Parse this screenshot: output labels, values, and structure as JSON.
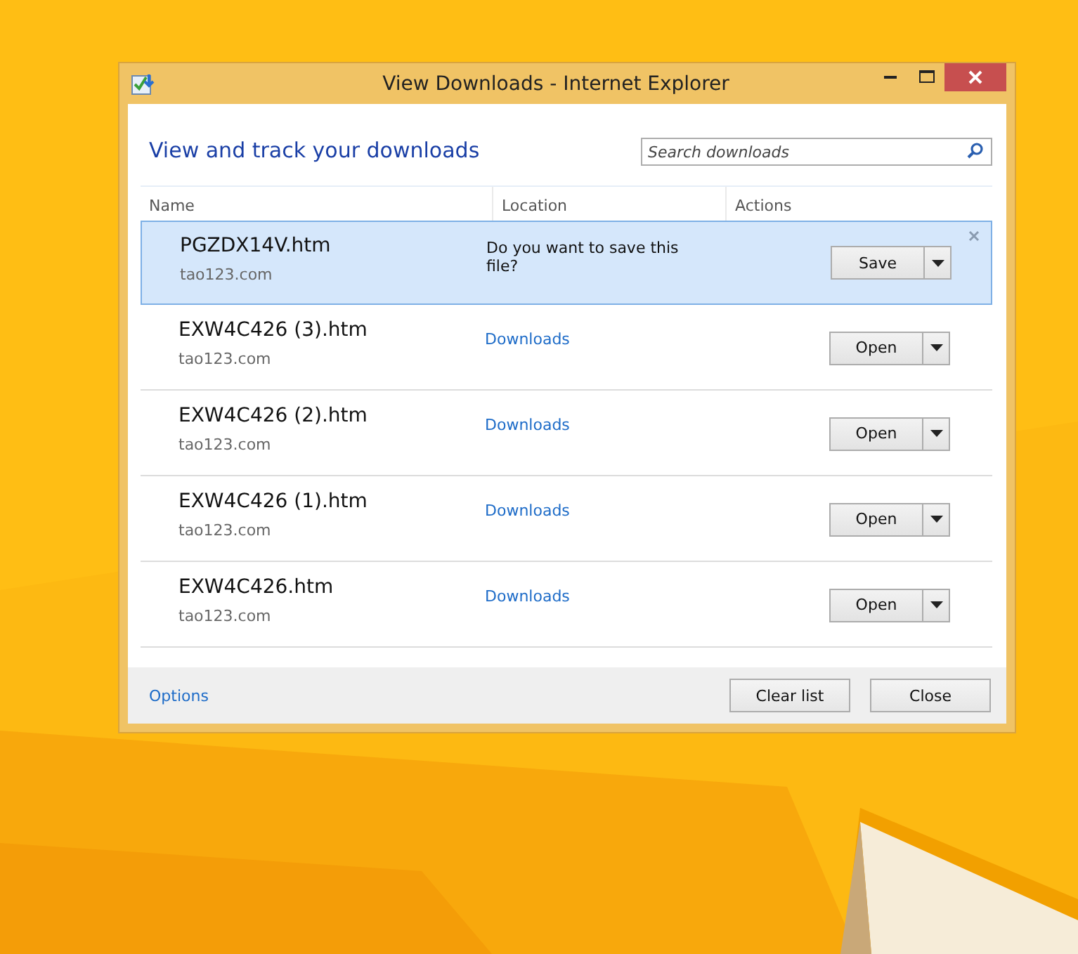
{
  "window": {
    "title": "View Downloads - Internet Explorer"
  },
  "heading": "View and track your downloads",
  "search": {
    "placeholder": "Search downloads"
  },
  "columns": [
    "Name",
    "Location",
    "Actions"
  ],
  "rows": [
    {
      "file": "PGZDX14V.htm",
      "source": "tao123.com",
      "kind": "prompt",
      "location": "Do you want to save this file?",
      "action": "Save",
      "selected": true
    },
    {
      "file": "EXW4C426 (3).htm",
      "source": "tao123.com",
      "kind": "link",
      "location": "Downloads",
      "action": "Open",
      "selected": false
    },
    {
      "file": "EXW4C426 (2).htm",
      "source": "tao123.com",
      "kind": "link",
      "location": "Downloads",
      "action": "Open",
      "selected": false
    },
    {
      "file": "EXW4C426 (1).htm",
      "source": "tao123.com",
      "kind": "link",
      "location": "Downloads",
      "action": "Open",
      "selected": false
    },
    {
      "file": "EXW4C426.htm",
      "source": "tao123.com",
      "kind": "link",
      "location": "Downloads",
      "action": "Open",
      "selected": false
    }
  ],
  "footer": {
    "options": "Options",
    "buttons": [
      "Clear list",
      "Close"
    ]
  }
}
